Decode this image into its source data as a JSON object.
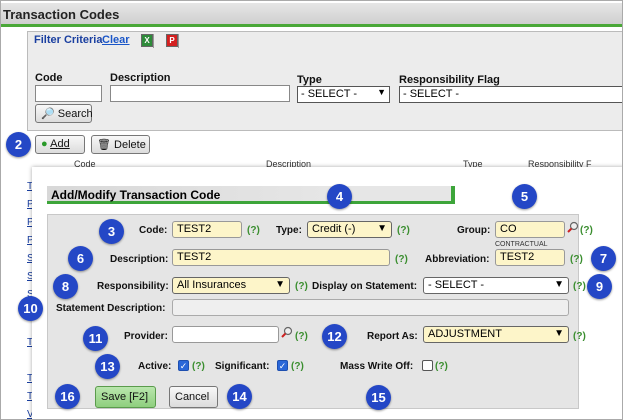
{
  "page": {
    "title": "Transaction Codes"
  },
  "filter": {
    "title": "Filter Criteria",
    "clear": "Clear",
    "code_label": "Code",
    "description_label": "Description",
    "type_label": "Type",
    "type_value": "- SELECT -",
    "responsibility_label": "Responsibility Flag",
    "responsibility_value": "- SELECT -",
    "search_label": "Search"
  },
  "toolbar": {
    "add": "Add",
    "delete": "Delete"
  },
  "bg_table": {
    "col_code": "Code",
    "col_description": "Description",
    "col_type": "Type",
    "col_resp": "Responsibility F"
  },
  "modal": {
    "title": "Add/Modify Transaction Code",
    "code_label": "Code:",
    "code_value": "TEST2",
    "type_label": "Type:",
    "type_value": "Credit (-)",
    "group_label": "Group:",
    "group_value": "CO",
    "group_hint": "CONTRACTUAL",
    "description_label": "Description:",
    "description_value": "TEST2",
    "abbreviation_label": "Abbreviation:",
    "abbreviation_value": "TEST2",
    "responsibility_label": "Responsibility:",
    "responsibility_value": "All Insurances",
    "display_label": "Display on Statement:",
    "display_value": "- SELECT -",
    "statement_label": "Statement Description:",
    "provider_label": "Provider:",
    "report_label": "Report As:",
    "report_value": "ADJUSTMENT",
    "active_label": "Active:",
    "significant_label": "Significant:",
    "mass_label": "Mass Write Off:",
    "help": "(?)",
    "save": "Save [F2]",
    "cancel": "Cancel"
  },
  "badges": [
    "2",
    "3",
    "4",
    "5",
    "6",
    "7",
    "8",
    "9",
    "10",
    "11",
    "12",
    "13",
    "14",
    "15",
    "16"
  ],
  "colors": {
    "badge": "#2447c6",
    "accent_green": "#3da53a",
    "required_yellow": "#fdf5c9",
    "help_green": "#3a8e2f"
  },
  "icons": [
    "excel-icon",
    "pdf-icon",
    "search-icon",
    "add-icon",
    "delete-icon",
    "magnifier-icon",
    "checkbox-icon"
  ]
}
